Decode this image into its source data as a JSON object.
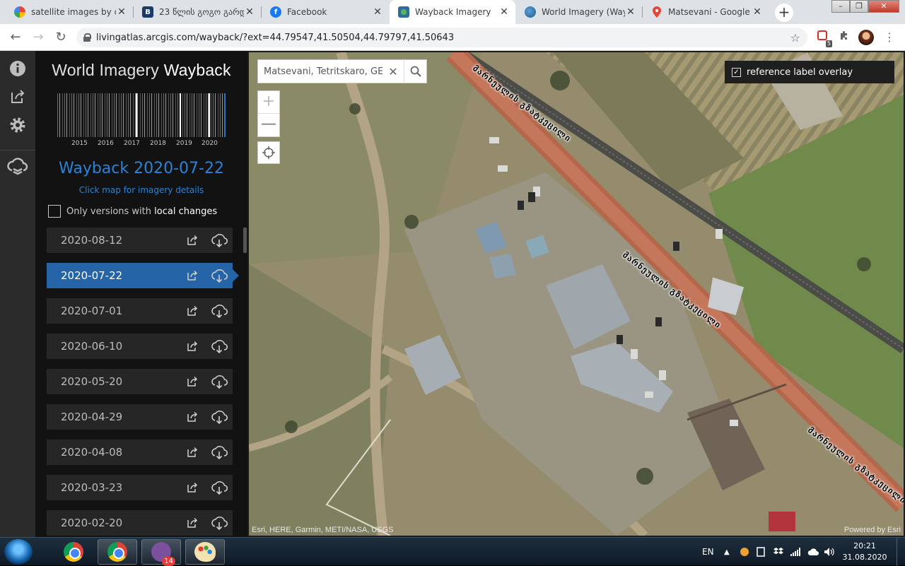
{
  "browser": {
    "tabs": [
      {
        "title": "satellite images by da",
        "favicon": "google-icon",
        "active": false
      },
      {
        "title": "23 წლის გოგო გარდ",
        "favicon": "blog-icon",
        "active": false
      },
      {
        "title": "Facebook",
        "favicon": "facebook-icon",
        "active": false
      },
      {
        "title": "Wayback Imagery",
        "favicon": "wayback-icon",
        "active": true
      },
      {
        "title": "World Imagery (Wayb",
        "favicon": "globe-icon",
        "active": false
      },
      {
        "title": "Matsevani - Google M",
        "favicon": "maps-pin-icon",
        "active": false
      }
    ],
    "url": "livingatlas.arcgis.com/wayback/?ext=44.79547,41.50504,44.79797,41.50643",
    "extension_badge": "5"
  },
  "sidebar": {
    "title_light": "World Imagery",
    "title_bold": "Wayback",
    "timeline_years": [
      "2015",
      "2016",
      "2017",
      "2018",
      "2019",
      "2020"
    ],
    "selected_heading": "Wayback 2020-07-22",
    "selected_subtitle": "Click map for imagery details",
    "filter_prefix": "Only versions with",
    "filter_bold": "local changes",
    "filter_checked": false,
    "releases": [
      {
        "date": "2020-08-12",
        "active": false
      },
      {
        "date": "2020-07-22",
        "active": true
      },
      {
        "date": "2020-07-01",
        "active": false
      },
      {
        "date": "2020-06-10",
        "active": false
      },
      {
        "date": "2020-05-20",
        "active": false
      },
      {
        "date": "2020-04-29",
        "active": false
      },
      {
        "date": "2020-04-08",
        "active": false
      },
      {
        "date": "2020-03-23",
        "active": false
      },
      {
        "date": "2020-02-20",
        "active": false
      }
    ],
    "accent_color": "#2565a7"
  },
  "map": {
    "search_value": "Matsevani, Tetritskaro, GE",
    "zoom_in_label": "+",
    "zoom_out_label": "—",
    "overlay_label": "reference label overlay",
    "overlay_checked": true,
    "road_labels": [
      "მარნეულის გზატკეცილი",
      "მარნეულის გზატკეცილი",
      "მარნეულის გზატკეცილი"
    ],
    "attribution": "Esri, HERE, Garmin, METI/NASA, USGS",
    "powered_by": "Powered by Esri"
  },
  "taskbar": {
    "apps": [
      "chrome-icon",
      "chrome-icon",
      "viber-icon",
      "paint-icon"
    ],
    "viber_badge": "14",
    "language": "EN",
    "time": "20:21",
    "date": "31.08.2020"
  }
}
